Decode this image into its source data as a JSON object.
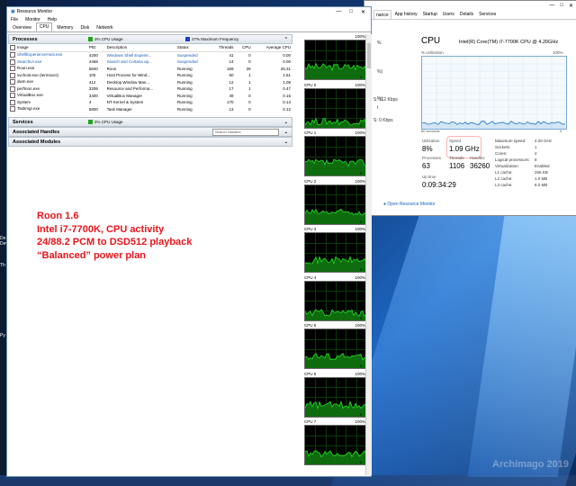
{
  "watermark": "Archimago 2019",
  "desktop": {
    "left_labels": [
      "Th",
      "Py",
      "De",
      "Dev"
    ]
  },
  "resmon": {
    "title": "Resource Monitor",
    "window_controls": [
      "—",
      "□",
      "✕"
    ],
    "menu": [
      "File",
      "Monitor",
      "Help"
    ],
    "tabs": [
      "Overview",
      "CPU",
      "Memory",
      "Disk",
      "Network"
    ],
    "active_tab": "CPU",
    "processes": {
      "header": "Processes",
      "usage_label": "3% CPU Usage",
      "freq_label": "27% Maximum Frequency",
      "columns": [
        "Image",
        "PID",
        "Description",
        "Status",
        "Threads",
        "CPU",
        "Average CPU"
      ],
      "rows": [
        {
          "image": "ShellExperienceHost.exe",
          "pid": "4200",
          "desc": "Windows Shell Experie...",
          "status": "Suspended",
          "threads": "41",
          "cpu": "0",
          "avg": "0.00",
          "blue": true
        },
        {
          "image": "SearchUI.exe",
          "pid": "4468",
          "desc": "Search and Cortana ap...",
          "status": "Suspended",
          "threads": "14",
          "cpu": "0",
          "avg": "0.00",
          "blue": true
        },
        {
          "image": "Roon.exe",
          "pid": "6840",
          "desc": "Roon",
          "status": "Running",
          "threads": "169",
          "cpu": "26",
          "avg": "25.31",
          "blue": false
        },
        {
          "image": "svchost.exe (termsvcs)",
          "pid": "100",
          "desc": "Host Process for Wind...",
          "status": "Running",
          "threads": "50",
          "cpu": "1",
          "avg": "1.61",
          "blue": false
        },
        {
          "image": "dwm.exe",
          "pid": "412",
          "desc": "Desktop Window Man...",
          "status": "Running",
          "threads": "12",
          "cpu": "1",
          "avg": "1.08",
          "blue": false
        },
        {
          "image": "perfmon.exe",
          "pid": "3206",
          "desc": "Resource and Performa...",
          "status": "Running",
          "threads": "17",
          "cpu": "1",
          "avg": "0.47",
          "blue": false
        },
        {
          "image": "VirtualBox.exe",
          "pid": "3400",
          "desc": "VirtualBox Manager",
          "status": "Running",
          "threads": "49",
          "cpu": "0",
          "avg": "0.15",
          "blue": false
        },
        {
          "image": "System",
          "pid": "4",
          "desc": "NT Kernel & System",
          "status": "Running",
          "threads": "170",
          "cpu": "0",
          "avg": "0.14",
          "blue": false
        },
        {
          "image": "Taskmgr.exe",
          "pid": "5800",
          "desc": "Task Manager",
          "status": "Running",
          "threads": "13",
          "cpu": "0",
          "avg": "0.12",
          "blue": false
        }
      ]
    },
    "services": {
      "header": "Services",
      "usage_label": "2% CPU Usage"
    },
    "handles": {
      "header": "Associated Handles",
      "search_placeholder": "Search Handles"
    },
    "modules": {
      "header": "Associated Modules"
    },
    "overlay_lines": [
      "Roon 1.6",
      "Intel i7-7700K, CPU activity",
      "24/88.2 PCM to DSD512 playback",
      "“Balanced” power plan"
    ],
    "graph_labels": [
      {
        "name": "",
        "max": "100%"
      },
      {
        "name": "CPU 0",
        "max": "100%"
      },
      {
        "name": "CPU 1",
        "max": "100%"
      },
      {
        "name": "CPU 2",
        "max": "100%"
      },
      {
        "name": "CPU 3",
        "max": "100%"
      },
      {
        "name": "CPU 4",
        "max": "100%"
      },
      {
        "name": "CPU 5",
        "max": "100%"
      },
      {
        "name": "CPU 6",
        "max": "100%"
      },
      {
        "name": "CPU 7",
        "max": "100%"
      }
    ],
    "graph_bottom_labels": [
      "0",
      "0",
      "0",
      "0",
      "0",
      "0",
      "0",
      "0",
      "0"
    ],
    "graph_levels": [
      0.32,
      0.16,
      0.33,
      0.3,
      0.3,
      0.2,
      0.3,
      0.3,
      0.28
    ]
  },
  "taskmgr": {
    "window_controls": [
      "—",
      "□",
      "✕"
    ],
    "tabs": [
      "nance",
      "App history",
      "Startup",
      "Users",
      "Details",
      "Services"
    ],
    "left_items": [
      "%",
      "%)",
      "%)",
      "t",
      "S: 112 Kbps",
      "S: 0 Kbps"
    ],
    "cpu_title": "CPU",
    "cpu_name": "Intel(R) Core(TM) i7-7700K CPU @ 4.20GHz",
    "util_label": "% Utilization",
    "pct_label": "100%",
    "time_label": "60 seconds",
    "zero_label": "0",
    "utilization_label": "Utilization",
    "utilization": "8%",
    "speed_label": "Speed",
    "speed": "1.09 GHz",
    "processes_label": "Processes",
    "processes": "63",
    "threads_label": "Threads",
    "threads": "1106",
    "handles_label": "Handles",
    "handles": "36260",
    "uptime_label": "Up time",
    "uptime": "0:09:34:29",
    "specs": [
      {
        "k": "Maximum speed:",
        "v": "4.20 GHz"
      },
      {
        "k": "Sockets:",
        "v": "1"
      },
      {
        "k": "Cores:",
        "v": "4"
      },
      {
        "k": "Logical processors:",
        "v": "8"
      },
      {
        "k": "Virtualization:",
        "v": "Enabled"
      },
      {
        "k": "L1 cache:",
        "v": "256 KB"
      },
      {
        "k": "L2 cache:",
        "v": "1.0 MB"
      },
      {
        "k": "L3 cache:",
        "v": "8.0 MB"
      }
    ],
    "open_resmon": "Open Resource Monitor"
  },
  "colors": {
    "cpu_usage": "#1da81d",
    "max_freq": "#1e3fd1",
    "graph_line": "#22e322",
    "graph_fill": "#0e6b0e",
    "overlay": "#e8141b"
  }
}
